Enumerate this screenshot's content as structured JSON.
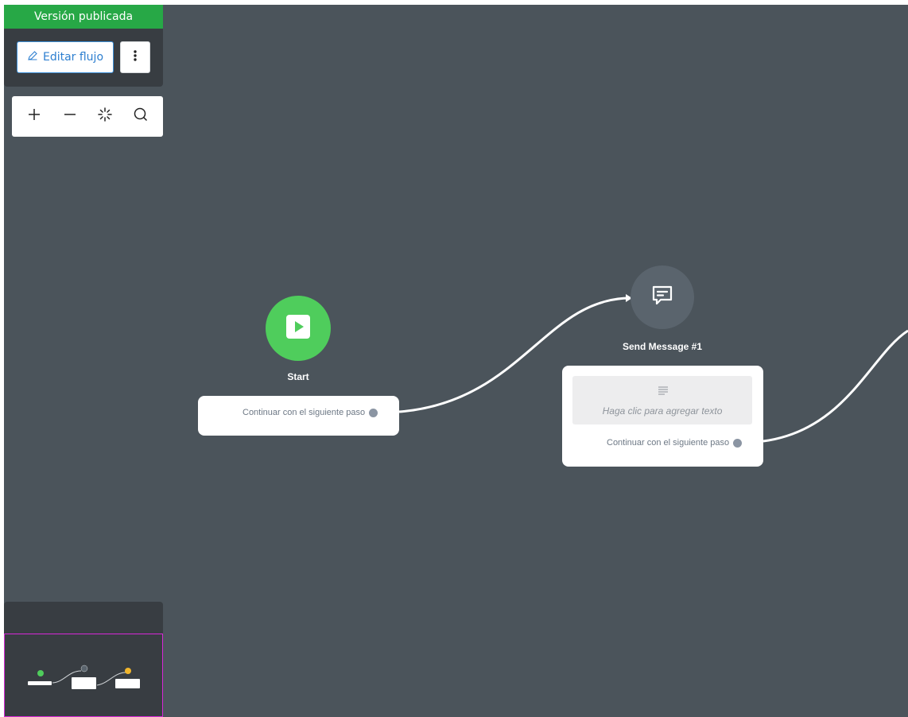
{
  "panel": {
    "status_banner": "Versión publicada",
    "edit_button": "Editar flujo",
    "more_icon": "vertical-dots-icon"
  },
  "zoom_toolbar": {
    "tools": [
      {
        "name": "zoom-in",
        "icon": "plus-icon"
      },
      {
        "name": "zoom-out",
        "icon": "minus-icon"
      },
      {
        "name": "auto-arrange",
        "icon": "sparkle-icon"
      },
      {
        "name": "search",
        "icon": "search-icon"
      }
    ]
  },
  "nodes": {
    "start": {
      "title": "Start",
      "icon": "play-icon",
      "color": "#4fcd5c",
      "next_step": "Continuar con el siguiente paso"
    },
    "send_message": {
      "title": "Send Message #1",
      "icon": "message-icon",
      "color": "#5a646d",
      "placeholder": "Haga clic para agregar texto",
      "next_step": "Continuar con el siguiente paso"
    }
  },
  "colors": {
    "canvas": "#4b545b",
    "panel": "#383d42",
    "published": "#27a846",
    "accent": "#2d7fd0",
    "minimap_border": "#d728d7"
  }
}
